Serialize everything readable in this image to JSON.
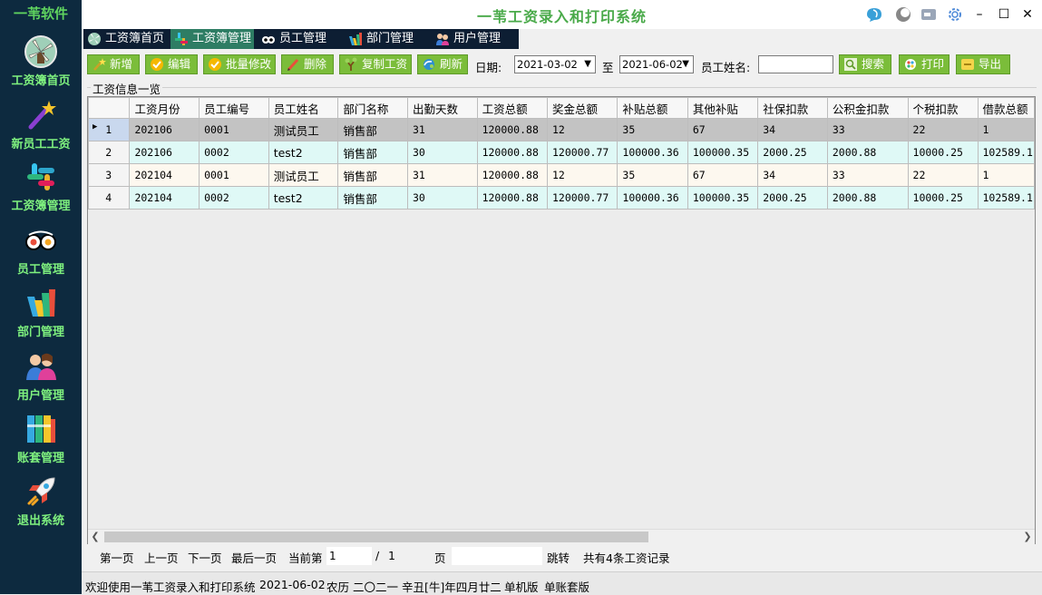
{
  "app": {
    "logo": "一苇软件",
    "title": "一苇工资录入和打印系统"
  },
  "sidebar": {
    "items": [
      {
        "label": "工资簿首页",
        "icon": "windmill-icon"
      },
      {
        "label": "新员工工资",
        "icon": "magic-wand-icon"
      },
      {
        "label": "工资簿管理",
        "icon": "slack-icon"
      },
      {
        "label": "员工管理",
        "icon": "tripadvisor-icon"
      },
      {
        "label": "部门管理",
        "icon": "dept-bars-icon"
      },
      {
        "label": "用户管理",
        "icon": "users-icon"
      },
      {
        "label": "账套管理",
        "icon": "books-icon"
      },
      {
        "label": "退出系统",
        "icon": "rocket-icon"
      }
    ]
  },
  "tabs": [
    {
      "label": "工资簿首页"
    },
    {
      "label": "工资簿管理"
    },
    {
      "label": "员工管理"
    },
    {
      "label": "部门管理"
    },
    {
      "label": "用户管理"
    }
  ],
  "toolbar": {
    "add": "新增",
    "edit": "编辑",
    "batch_edit": "批量修改",
    "delete": "删除",
    "copy": "复制工资",
    "refresh": "刷新",
    "date_label": "日期:",
    "date_from": "2021-03-02",
    "to_label": "至",
    "date_to": "2021-06-02",
    "name_label": "员工姓名:",
    "name_value": "",
    "search": "搜索",
    "print": "打印",
    "export": "导出"
  },
  "group": {
    "title": "工资信息一览"
  },
  "table": {
    "columns": [
      "工资月份",
      "员工编号",
      "员工姓名",
      "部门名称",
      "出勤天数",
      "工资总额",
      "奖金总额",
      "补贴总额",
      "其他补贴",
      "社保扣款",
      "公积金扣款",
      "个税扣款",
      "借款总额"
    ],
    "rows": [
      [
        "1",
        "202106",
        "0001",
        "测试员工",
        "销售部",
        "31",
        "120000.88",
        "12",
        "35",
        "67",
        "34",
        "33",
        "22",
        "1"
      ],
      [
        "2",
        "202106",
        "0002",
        "test2",
        "销售部",
        "30",
        "120000.88",
        "120000.77",
        "100000.36",
        "100000.35",
        "2000.25",
        "2000.88",
        "10000.25",
        "102589.1"
      ],
      [
        "3",
        "202104",
        "0001",
        "测试员工",
        "销售部",
        "31",
        "120000.88",
        "12",
        "35",
        "67",
        "34",
        "33",
        "22",
        "1"
      ],
      [
        "4",
        "202104",
        "0002",
        "test2",
        "销售部",
        "30",
        "120000.88",
        "120000.77",
        "100000.36",
        "100000.35",
        "2000.25",
        "2000.88",
        "10000.25",
        "102589.1"
      ]
    ]
  },
  "pager": {
    "first": "第一页",
    "prev": "上一页",
    "next": "下一页",
    "last": "最后一页",
    "current_label": "当前第",
    "current": "1",
    "sep": "/",
    "total": "1",
    "page_label": "页",
    "jump_value": "",
    "jump": "跳转",
    "summary": "共有4条工资记录"
  },
  "status": {
    "welcome": "欢迎使用一苇工资录入和打印系统",
    "date": "2021-06-02",
    "lunar": "农历 二〇二一 辛丑[牛]年四月廿二",
    "edition": "单机版",
    "account": "单账套版"
  },
  "colors": {
    "sidebar": "#0d2a3f",
    "accent": "#7bbd3a",
    "tab_active": "#2e7d64",
    "label": "#7ef07e"
  }
}
